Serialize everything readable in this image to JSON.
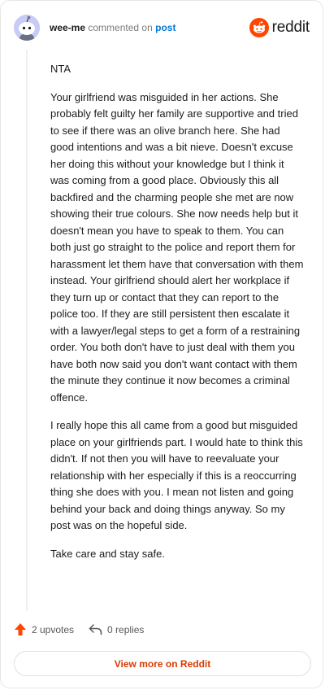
{
  "header": {
    "username": "wee-me",
    "action_text": "commented on",
    "post_link": "post",
    "brand": "reddit",
    "avatar_icon": "snoo-avatar-icon",
    "brand_icon": "reddit-logo-icon"
  },
  "comment": {
    "paragraphs": [
      "NTA",
      "Your girlfriend was misguided in her actions. She probably felt guilty her family are supportive and tried to see if there was an olive branch here. She had good intentions and was a bit nieve. Doesn't excuse her doing this without your knowledge but I think it was coming from a good place. Obviously this all backfired and the charming people she met are now showing their true colours. She now needs help but it doesn't mean you have to speak to them. You can both just go straight to the police and report them for harassment let them have that conversation with them instead. Your girlfriend should alert her workplace if they turn up or contact that they can report to the police too. If they are still persistent then escalate it with a lawyer/legal steps to get a form of a restraining order. You both don't have to just deal with them you have both now said you don't want contact with them the minute they continue it now becomes a criminal offence.",
      "I really hope this all came from a good but misguided place on your girlfriends part. I would hate to think this didn't. If not then you will have to reevaluate your relationship with her especially if this is a reoccurring thing she does with you. I mean not listen and going behind your back and doing things anyway. So my post was on the hopeful side.",
      "Take care and stay safe."
    ]
  },
  "actions": {
    "upvotes": "2 upvotes",
    "replies": "0 replies",
    "upvote_icon": "upvote-arrow-icon",
    "reply_icon": "reply-arrow-icon"
  },
  "footer": {
    "view_more": "View more on Reddit"
  },
  "colors": {
    "brand_orange": "#ff4500",
    "link_blue": "#0079d3",
    "view_more_text": "#d93a00",
    "avatar_bg": "#c7cbf5"
  }
}
